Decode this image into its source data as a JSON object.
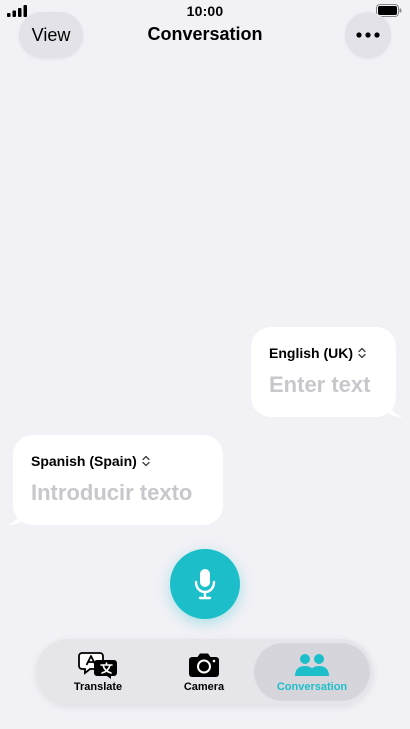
{
  "status_bar": {
    "time": "10:00"
  },
  "nav": {
    "title": "Conversation",
    "view_label": "View"
  },
  "bubbles": {
    "right": {
      "language": "English (UK)",
      "placeholder": "Enter text"
    },
    "left": {
      "language": "Spanish (Spain)",
      "placeholder": "Introducir texto"
    }
  },
  "tabs": [
    {
      "label": "Translate"
    },
    {
      "label": "Camera"
    },
    {
      "label": "Conversation"
    }
  ],
  "colors": {
    "accent": "#1cbfc9",
    "background": "#f2f1f6",
    "placeholder": "#c7c7cc"
  },
  "icons": {
    "signal": "signal-icon",
    "battery": "battery-icon",
    "more": "ellipsis-icon",
    "selector": "chevron-up-down-icon",
    "mic": "microphone-icon",
    "translate": "translate-icon",
    "camera": "camera-icon",
    "conversation": "people-icon"
  }
}
